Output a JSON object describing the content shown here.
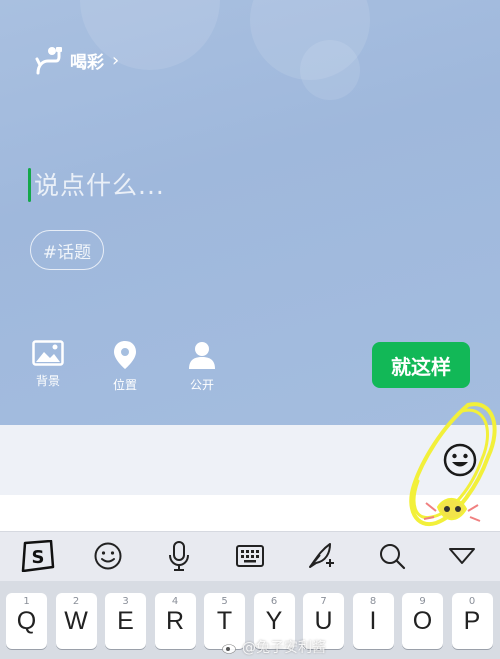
{
  "compose": {
    "cheer_label": "喝彩",
    "placeholder": "说点什么...",
    "topic_chip": "#话题"
  },
  "tools": {
    "background_label": "背景",
    "location_label": "位置",
    "visibility_label": "公开"
  },
  "submit_label": "就这样",
  "keyboard": {
    "toolbar_icons": [
      "sogou-logo-icon",
      "emoji-smile-icon",
      "microphone-icon",
      "keyboard-icon",
      "handwriting-icon",
      "search-icon",
      "collapse-keyboard-icon"
    ],
    "row1": [
      {
        "hint": "1",
        "key": "Q"
      },
      {
        "hint": "2",
        "key": "W"
      },
      {
        "hint": "3",
        "key": "E"
      },
      {
        "hint": "4",
        "key": "R"
      },
      {
        "hint": "5",
        "key": "T"
      },
      {
        "hint": "6",
        "key": "Y"
      },
      {
        "hint": "7",
        "key": "U"
      },
      {
        "hint": "8",
        "key": "I"
      },
      {
        "hint": "9",
        "key": "O"
      },
      {
        "hint": "0",
        "key": "P"
      }
    ]
  },
  "watermark": "@兔子安利酱",
  "colors": {
    "accent_green": "#12b857",
    "caret_green": "#14a84a",
    "annotation_yellow": "#f2f03a"
  }
}
